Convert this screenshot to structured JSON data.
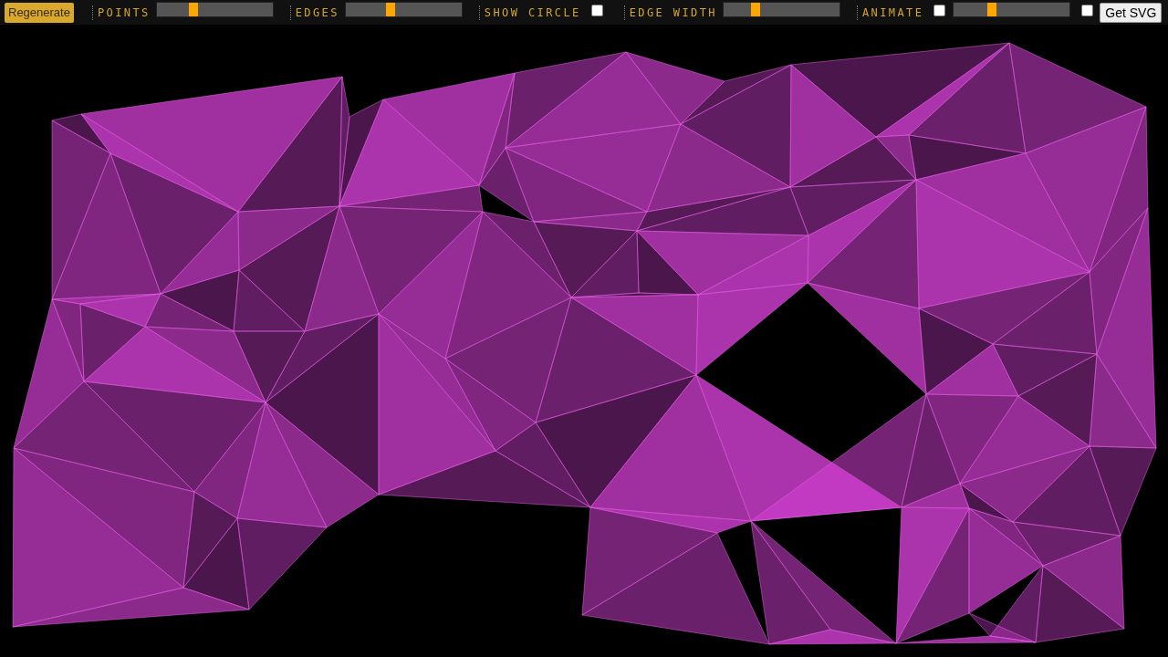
{
  "toolbar": {
    "regenerate_button": "Regenerate",
    "controls": [
      {
        "kind": "slider",
        "label": "POINTS",
        "level": 0.3
      },
      {
        "kind": "slider",
        "label": "EDGES",
        "level": 0.37
      },
      {
        "kind": "checkbox",
        "label": "SHOW CIRCLE",
        "checked": false
      },
      {
        "kind": "slider",
        "label": "EDGE WIDTH",
        "level": 0.25
      },
      {
        "kind": "checkbox-slider",
        "label": "ANIMATE",
        "checked": false,
        "level": 0.31
      }
    ],
    "extra_checkbox": {
      "checked": false
    },
    "get_svg_button": "Get SVG"
  }
}
